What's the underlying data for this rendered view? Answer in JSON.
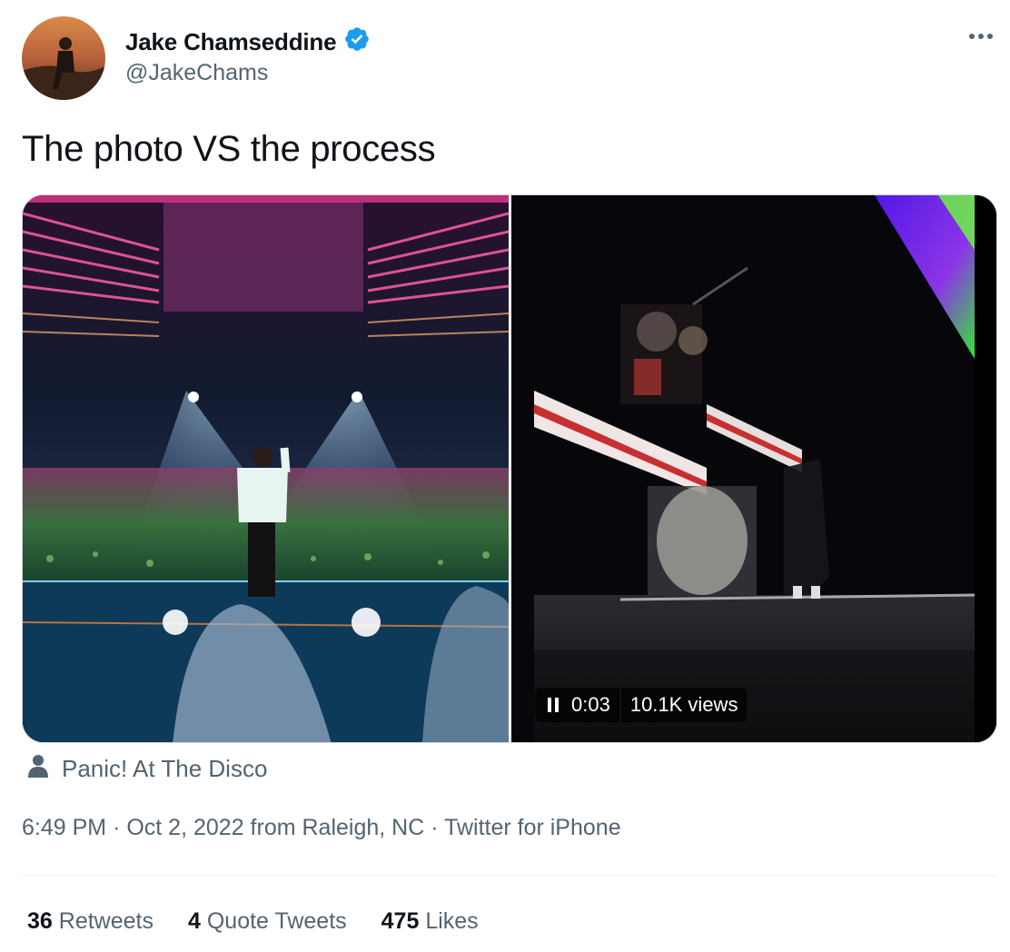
{
  "author": {
    "display_name": "Jake Chamseddine",
    "handle": "@JakeChams",
    "verified": true
  },
  "more_icon": "more-horizontal-icon",
  "tweet": {
    "text": "The photo VS the process"
  },
  "video": {
    "time": "0:03",
    "views": "10.1K views",
    "state_icon": "pause-icon"
  },
  "tagged": {
    "icon": "person-icon",
    "label": "Panic! At The Disco"
  },
  "meta": {
    "time": "6:49 PM",
    "date": "Oct 2, 2022",
    "location": "from Raleigh, NC",
    "source": "Twitter for iPhone",
    "separator": "·"
  },
  "stats": [
    {
      "count": "36",
      "label": "Retweets"
    },
    {
      "count": "4",
      "label": "Quote Tweets"
    },
    {
      "count": "475",
      "label": "Likes"
    }
  ],
  "colors": {
    "verified": "#1d9bf0",
    "secondary_text": "#536471",
    "primary_text": "#0f1419"
  }
}
